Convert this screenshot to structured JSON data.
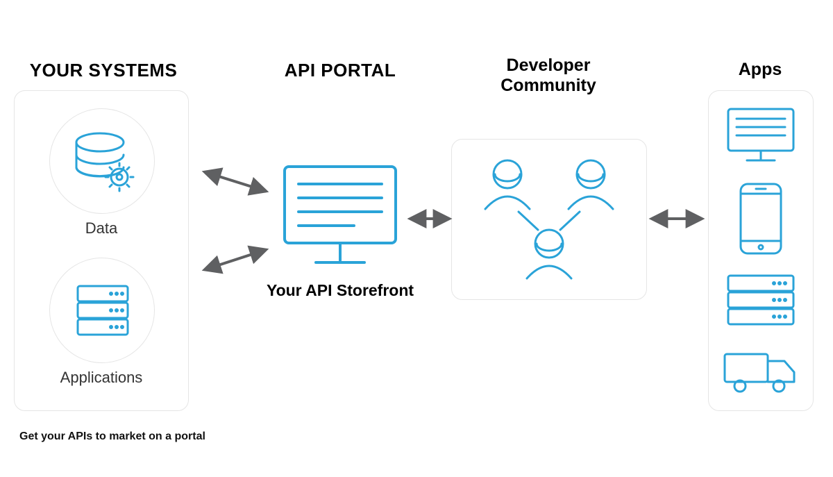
{
  "columns": {
    "systems": {
      "title": "YOUR SYSTEMS",
      "data_label": "Data",
      "apps_label": "Applications"
    },
    "portal": {
      "title": "API PORTAL",
      "storefront_label": "Your API Storefront"
    },
    "devs": {
      "title": "Developer Community"
    },
    "apps": {
      "title": "Apps"
    }
  },
  "caption": "Get your APIs to market on a portal",
  "icons": {
    "data": "database-gear-icon",
    "applications": "server-icon",
    "storefront": "monitor-icon",
    "developer": "person-icon",
    "app_monitor": "monitor-icon",
    "app_phone": "phone-icon",
    "app_server": "server-icon",
    "app_truck": "truck-icon"
  },
  "colors": {
    "stroke": "#2aa3d8",
    "arrow": "#5f6062",
    "panel": "#e5e5e5"
  }
}
